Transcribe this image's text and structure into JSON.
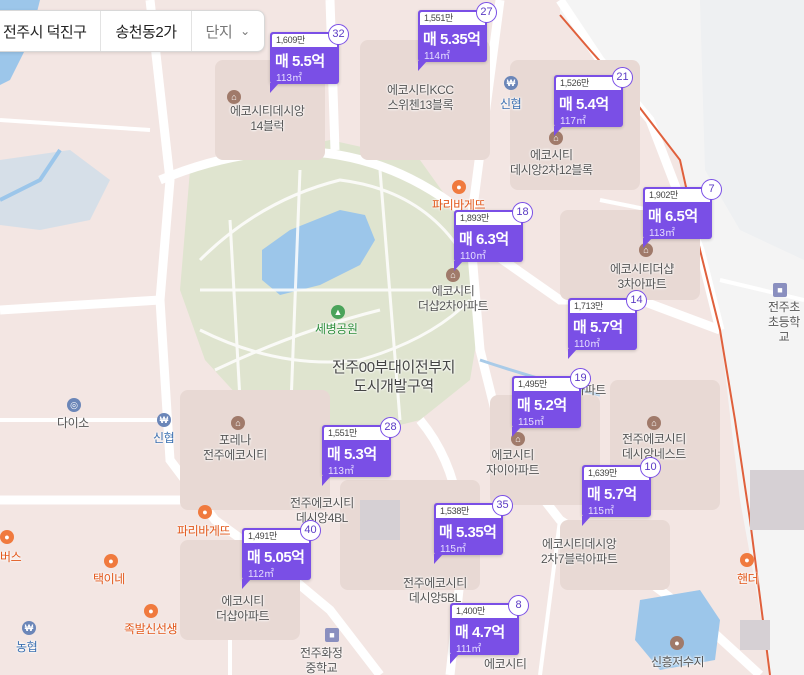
{
  "breadcrumb": {
    "region": "전주시 덕진구",
    "dong": "송천동2가",
    "type_selector": "단지"
  },
  "markers": [
    {
      "unit_price": "1,609만",
      "price": "매 5.5억",
      "area": "113㎡",
      "count": "32"
    },
    {
      "unit_price": "1,551만",
      "price": "매 5.35억",
      "area": "114㎡",
      "count": "27"
    },
    {
      "unit_price": "1,526만",
      "price": "매 5.4억",
      "area": "117㎡",
      "count": "21"
    },
    {
      "unit_price": "1,902만",
      "price": "매 6.5억",
      "area": "113㎡",
      "count": "7"
    },
    {
      "unit_price": "1,893만",
      "price": "매 6.3억",
      "area": "110㎡",
      "count": "18"
    },
    {
      "unit_price": "1,713만",
      "price": "매 5.7억",
      "area": "110㎡",
      "count": "14"
    },
    {
      "unit_price": "1,495만",
      "price": "매 5.2억",
      "area": "115㎡",
      "count": "19"
    },
    {
      "unit_price": "1,551만",
      "price": "매 5.3억",
      "area": "113㎡",
      "count": "28"
    },
    {
      "unit_price": "1,639만",
      "price": "매 5.7억",
      "area": "115㎡",
      "count": "10"
    },
    {
      "unit_price": "1,538만",
      "price": "매 5.35억",
      "area": "115㎡",
      "count": "35"
    },
    {
      "unit_price": "1,491만",
      "price": "매 5.05억",
      "area": "112㎡",
      "count": "40"
    },
    {
      "unit_price": "1,400만",
      "price": "매 4.7억",
      "area": "111㎡",
      "count": "8"
    }
  ],
  "places": {
    "ecocity14": "에코시티데시앙\n14블럭",
    "kcc13": "에코시티KCC\n스위첸13블록",
    "shinhyup_top": "신협",
    "desian12": "에코시티\n데시앙2차12블록",
    "paris_top": "파리바게뜨",
    "desharp3": "에코시티더샵\n3차아파트",
    "desharp2": "에코시티\n더샵2차아파트",
    "sebyeong_park": "세병공원",
    "dev_zone": "전주00부대이전부지\n도시개발구역",
    "daiso": "다이소",
    "shinhyup_left": "신협",
    "forena": "포레나\n전주에코시티",
    "jaia_top": "아파트",
    "ecocity_jaia": "에코시티\n자이아파트",
    "desiannest": "전주에코시티\n데시앙네스트",
    "desian4bl": "전주에코시티\n데시앙4BL",
    "paris_bottom": "파리바게뜨",
    "desian2_7": "에코시티데시앙\n2차7블럭아파트",
    "desian5bl": "전주에코시티\n데시앙5BL",
    "burgers": "버스",
    "taekine": "택이네",
    "desharp_apt": "에코시티\n더샵아파트",
    "jokbal": "족발신선생",
    "hwajeong": "전주화정\n중학교",
    "nonghyup": "농협",
    "ecocity_bottom": "에코시티",
    "handel": "핸더",
    "jeonju_elem": "전주초\n초등학교",
    "singheung": "신흥저수지"
  }
}
